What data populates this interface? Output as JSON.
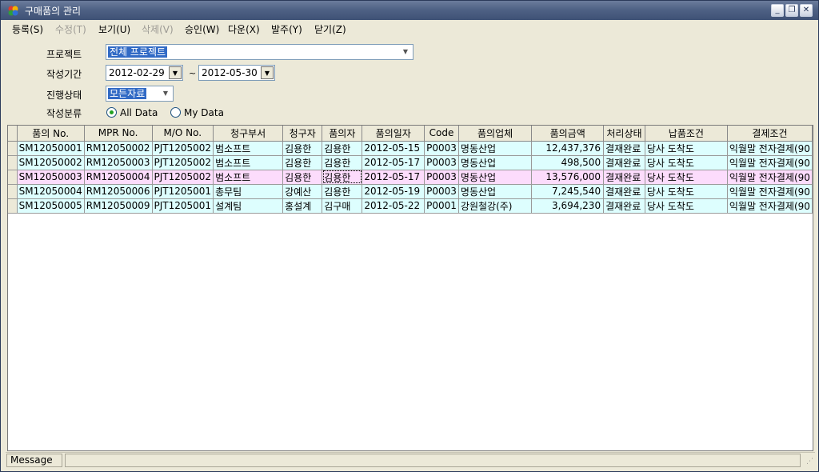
{
  "window": {
    "title": "구매품의 관리",
    "controls": {
      "minimize": "_",
      "restore": "❐",
      "close": "✕"
    }
  },
  "menu": [
    {
      "label": "등록(S)",
      "enabled": true
    },
    {
      "label": "수정(T)",
      "enabled": false
    },
    {
      "label": "보기(U)",
      "enabled": true
    },
    {
      "label": "삭제(V)",
      "enabled": false
    },
    {
      "label": "승인(W)",
      "enabled": true
    },
    {
      "label": "다운(X)",
      "enabled": true
    },
    {
      "label": "발주(Y)",
      "enabled": true
    },
    {
      "label": "닫기(Z)",
      "enabled": true
    }
  ],
  "filters": {
    "project_label": "프로젝트",
    "project_value": "전체 프로젝트",
    "period_label": "작성기간",
    "date_from": "2012-02-29",
    "date_sep": "~",
    "date_to": "2012-05-30",
    "status_label": "진행상태",
    "status_value": "모든자료",
    "category_label": "작성분류",
    "radio_all": "All Data",
    "radio_my": "My Data",
    "selected_radio": "All Data"
  },
  "grid": {
    "columns": [
      "품의 No.",
      "MPR No.",
      "M/O No.",
      "청구부서",
      "청구자",
      "품의자",
      "품의일자",
      "Code",
      "품의업체",
      "품의금액",
      "처리상태",
      "납품조건",
      "결제조건"
    ],
    "rows": [
      {
        "style": "cyan",
        "cells": [
          "SM12050001",
          "RM12050002",
          "PJT1205002",
          "범소프트",
          "김용한",
          "김용한",
          "2012-05-15",
          "P0003",
          "명동산업",
          "12,437,376",
          "결재완료",
          "당사 도착도",
          "익월말 전자결제(90"
        ]
      },
      {
        "style": "cyan",
        "cells": [
          "SM12050002",
          "RM12050003",
          "PJT1205002",
          "범소프트",
          "김용한",
          "김용한",
          "2012-05-17",
          "P0003",
          "명동산업",
          "498,500",
          "결재완료",
          "당사 도착도",
          "익월말 전자결제(90"
        ]
      },
      {
        "style": "pink",
        "cells": [
          "SM12050003",
          "RM12050004",
          "PJT1205002",
          "범소프트",
          "김용한",
          "김용한",
          "2012-05-17",
          "P0003",
          "명동산업",
          "13,576,000",
          "결재완료",
          "당사 도착도",
          "익월말 전자결제(90"
        ]
      },
      {
        "style": "cyan",
        "cells": [
          "SM12050004",
          "RM12050006",
          "PJT1205001",
          "총무팀",
          "강예산",
          "김용한",
          "2012-05-19",
          "P0003",
          "명동산업",
          "7,245,540",
          "결재완료",
          "당사 도착도",
          "익월말 전자결제(90"
        ]
      },
      {
        "style": "cyan",
        "cells": [
          "SM12050005",
          "RM12050009",
          "PJT1205001",
          "설계팀",
          "홍설계",
          "김구매",
          "2012-05-22",
          "P0001",
          "강원철강(주)",
          "3,694,230",
          "결재완료",
          "당사 도착도",
          "익월말 전자결제(90"
        ]
      }
    ],
    "focused_cell": {
      "row": 2,
      "col": 5
    }
  },
  "statusbar": {
    "message": "Message"
  },
  "colors": {
    "titlebar": "#4f6285",
    "selection": "#316ac5",
    "row_cyan": "#ddfefe",
    "row_pink": "#fcdcfc",
    "face": "#ece9d8"
  }
}
